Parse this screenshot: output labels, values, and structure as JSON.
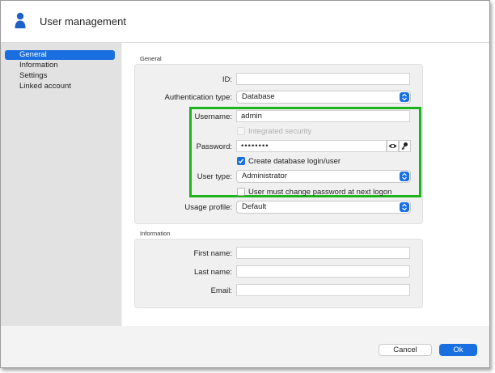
{
  "window": {
    "title": "User management",
    "accent": "#1a6fe0",
    "highlight_color": "#1db31d"
  },
  "sidebar": {
    "items": [
      {
        "label": "General",
        "active": true
      },
      {
        "label": "Information",
        "active": false
      },
      {
        "label": "Settings",
        "active": false
      },
      {
        "label": "Linked account",
        "active": false
      }
    ]
  },
  "general": {
    "section_label": "General",
    "id_label": "ID:",
    "id_value": "",
    "auth_label": "Authentication type:",
    "auth_value": "Database",
    "username_label": "Username:",
    "username_value": "admin",
    "integrated_label": "Integrated security",
    "password_label": "Password:",
    "password_value": "••••••••",
    "create_db_label": "Create database login/user",
    "usertype_label": "User type:",
    "usertype_value": "Administrator",
    "must_change_label": "User must change password at next logon",
    "usage_label": "Usage profile:",
    "usage_value": "Default"
  },
  "information": {
    "section_label": "Information",
    "first_name_label": "First name:",
    "first_name_value": "",
    "last_name_label": "Last name:",
    "last_name_value": "",
    "email_label": "Email:",
    "email_value": ""
  },
  "footer": {
    "cancel_label": "Cancel",
    "ok_label": "Ok"
  },
  "icons": [
    "user-icon",
    "eye-icon",
    "key-icon",
    "chevron-updown-icon",
    "checkmark-icon"
  ]
}
